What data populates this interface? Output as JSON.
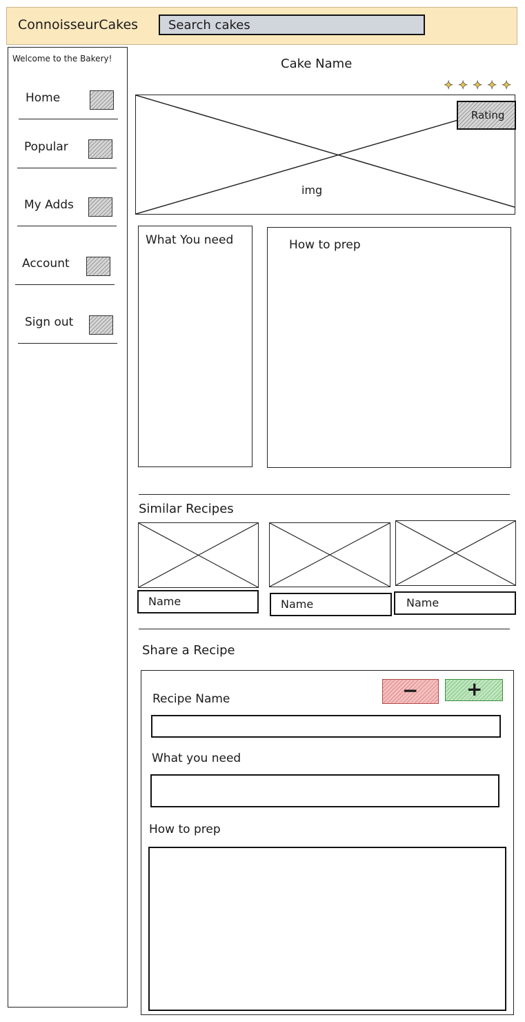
{
  "header": {
    "brand": "ConnoisseurCakes",
    "search_placeholder": "Search cakes",
    "bg_color": "#fbe8bd",
    "search_bg": "#d1d5dc"
  },
  "sidebar": {
    "welcome": "Welcome to the Bakery!",
    "items": [
      {
        "label": "Home"
      },
      {
        "label": "Popular"
      },
      {
        "label": "My Adds"
      },
      {
        "label": "Account"
      },
      {
        "label": "Sign out"
      }
    ]
  },
  "recipe": {
    "name": "Cake Name",
    "image_label": "img",
    "rating_label": "Rating",
    "ingredients_heading": "What You need",
    "prep_heading": "How to prep"
  },
  "similar": {
    "heading": "Similar Recipes",
    "cards": [
      {
        "name": "Name"
      },
      {
        "name": "Name"
      },
      {
        "name": "Name"
      }
    ]
  },
  "share": {
    "heading": "Share a Recipe",
    "remove_symbol": "−",
    "add_symbol": "+",
    "remove_color": "#f3c0c0",
    "add_color": "#bfe6bf",
    "recipe_name_label": "Recipe Name",
    "ingredients_label": "What you need",
    "prep_label": "How to prep"
  }
}
